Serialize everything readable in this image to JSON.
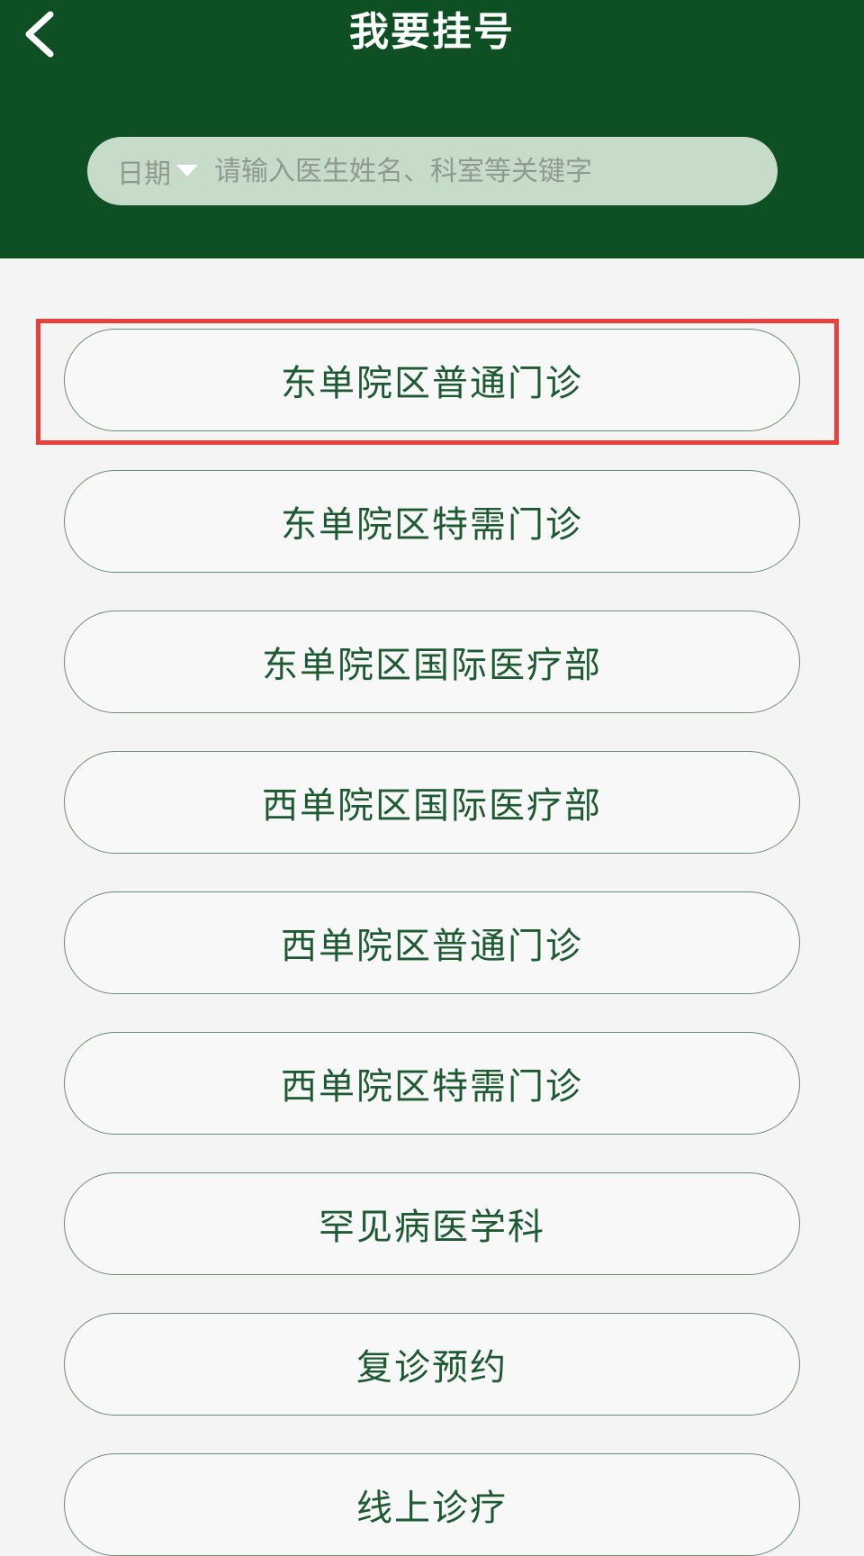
{
  "header": {
    "title": "我要挂号",
    "back_icon": "chevron-left-icon",
    "background_color": "#0f4f24"
  },
  "search": {
    "date_label": "日期",
    "placeholder": "请输入医生姓名、科室等关键字"
  },
  "menu": {
    "items": [
      {
        "label": "东单院区普通门诊"
      },
      {
        "label": "东单院区特需门诊"
      },
      {
        "label": "东单院区国际医疗部"
      },
      {
        "label": "西单院区国际医疗部"
      },
      {
        "label": "西单院区普通门诊"
      },
      {
        "label": "西单院区特需门诊"
      },
      {
        "label": "罕见病医学科"
      },
      {
        "label": "复诊预约"
      },
      {
        "label": "线上诊疗"
      }
    ]
  },
  "colors": {
    "accent": "#0f4f24",
    "item_text": "#1d5a32",
    "highlight": "#e8403a"
  }
}
